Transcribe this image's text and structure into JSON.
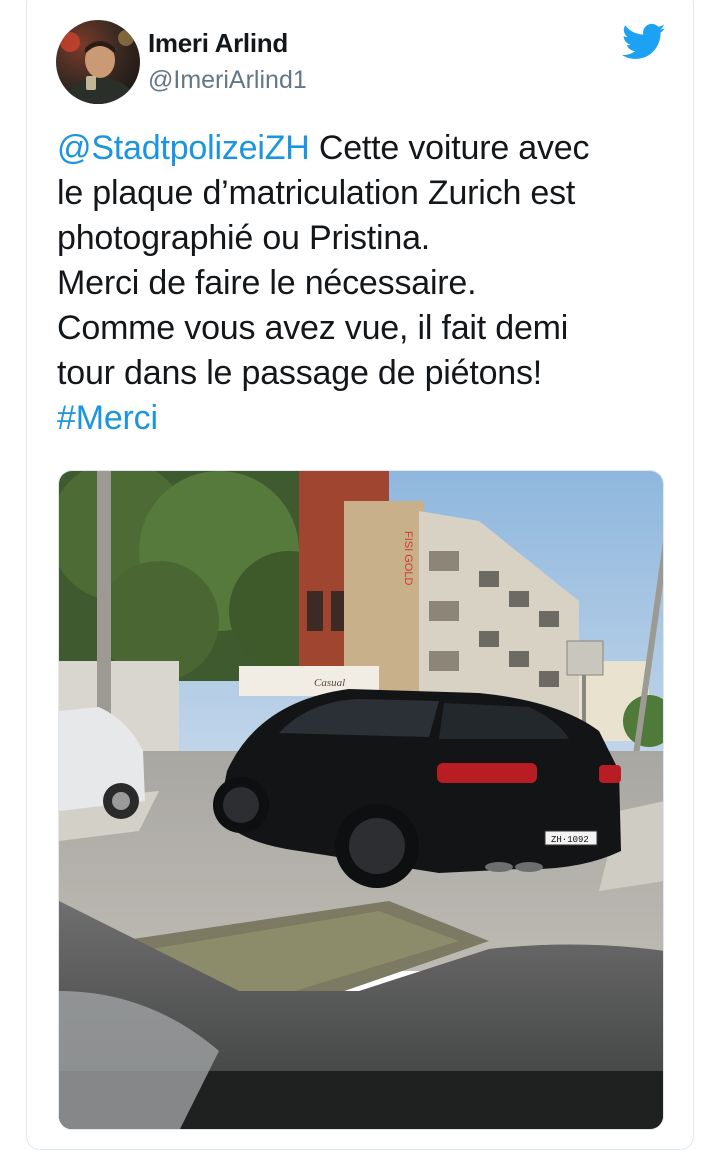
{
  "tweet": {
    "display_name": "Imeri Arlind",
    "handle": "@ImeriArlind1",
    "mention": "@StadtpolizeiZH",
    "text_lines": [
      " Cette voiture avec",
      "le plaque d’matriculation Zurich est",
      "photographié ou Pristina.",
      "Merci de faire le nécessaire.",
      "Comme vous avez vue, il fait demi",
      "tour dans le passage de piétons!"
    ],
    "hashtag": "#Merci"
  },
  "media": {
    "sign_text": "FISI GOLD",
    "store_sign": "Casual",
    "license_plate": "ZH·1092"
  },
  "colors": {
    "link": "#1b95e0",
    "text": "#14171a",
    "secondary": "#657786",
    "twitter_blue": "#1da1f2"
  },
  "icons": {
    "logo": "twitter-bird-icon"
  }
}
